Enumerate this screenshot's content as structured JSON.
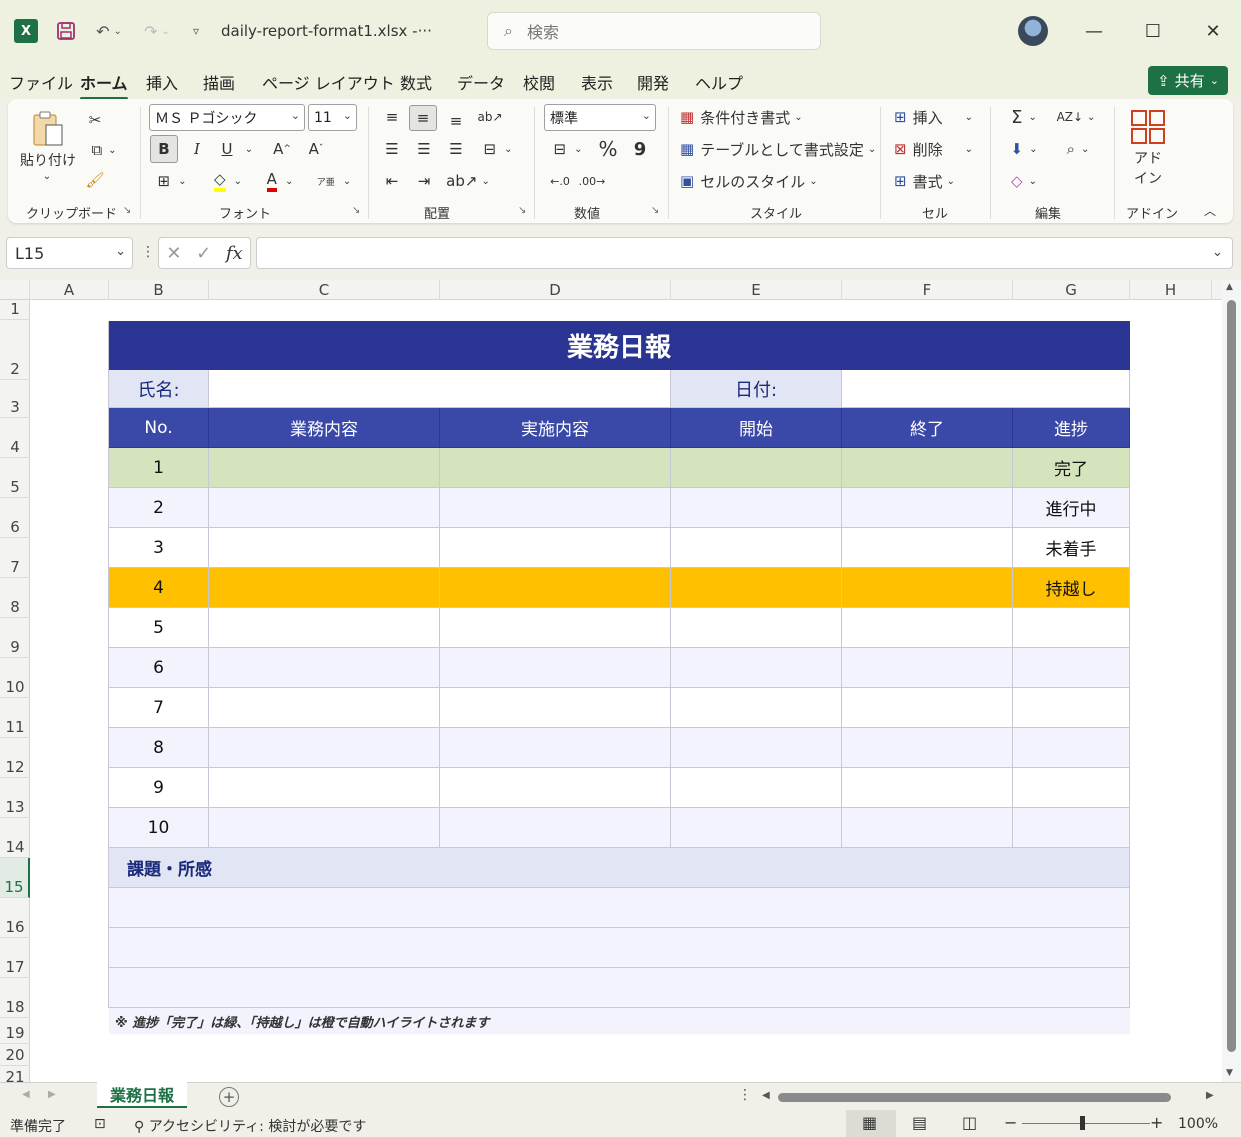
{
  "titlebar": {
    "filename": "daily-report-format1.xlsx  -···",
    "search_placeholder": "検索"
  },
  "ribbon_tabs": [
    {
      "label": "ファイル"
    },
    {
      "label": "ホーム",
      "active": true
    },
    {
      "label": "挿入"
    },
    {
      "label": "描画"
    },
    {
      "label": "ページ レイアウト"
    },
    {
      "label": "数式"
    },
    {
      "label": "データ"
    },
    {
      "label": "校閲"
    },
    {
      "label": "表示"
    },
    {
      "label": "開発"
    },
    {
      "label": "ヘルプ"
    }
  ],
  "share_label": "共有",
  "ribbon": {
    "clipboard": {
      "paste": "貼り付け",
      "group": "クリップボード"
    },
    "font": {
      "font_name": "ＭＳ Ｐゴシック",
      "font_size": "11",
      "bold": "B",
      "italic": "I",
      "underline": "U",
      "group": "フォント"
    },
    "alignment": {
      "group": "配置"
    },
    "number": {
      "format": "標準",
      "percent": "%",
      "comma": "9",
      "group": "数値"
    },
    "styles": {
      "conditional": "条件付き書式",
      "as_table": "テーブルとして書式設定",
      "cell_styles": "セルのスタイル",
      "group": "スタイル"
    },
    "cells": {
      "insert": "挿入",
      "delete": "削除",
      "format": "書式",
      "group": "セル"
    },
    "editing": {
      "group": "編集"
    },
    "addin": {
      "label_line1": "アド",
      "label_line2": "イン",
      "group": "アドイン"
    }
  },
  "formula_bar": {
    "namebox": "L15",
    "formula": ""
  },
  "columns": [
    "A",
    "B",
    "C",
    "D",
    "E",
    "F",
    "G",
    "H"
  ],
  "rows": [
    "1",
    "2",
    "3",
    "4",
    "5",
    "6",
    "7",
    "8",
    "9",
    "10",
    "11",
    "12",
    "13",
    "14",
    "15",
    "16",
    "17",
    "18",
    "19",
    "20",
    "21"
  ],
  "selected_row": "15",
  "report": {
    "title": "業務日報",
    "name_label": "氏名:",
    "name_value": "",
    "date_label": "日付:",
    "date_value": "",
    "headers": [
      "No.",
      "業務内容",
      "実施内容",
      "開始",
      "終了",
      "進捗"
    ],
    "rows": [
      {
        "no": "1",
        "task": "",
        "detail": "",
        "start": "",
        "end": "",
        "status": "完了"
      },
      {
        "no": "2",
        "task": "",
        "detail": "",
        "start": "",
        "end": "",
        "status": "進行中"
      },
      {
        "no": "3",
        "task": "",
        "detail": "",
        "start": "",
        "end": "",
        "status": "未着手"
      },
      {
        "no": "4",
        "task": "",
        "detail": "",
        "start": "",
        "end": "",
        "status": "持越し"
      },
      {
        "no": "5",
        "task": "",
        "detail": "",
        "start": "",
        "end": "",
        "status": ""
      },
      {
        "no": "6",
        "task": "",
        "detail": "",
        "start": "",
        "end": "",
        "status": ""
      },
      {
        "no": "7",
        "task": "",
        "detail": "",
        "start": "",
        "end": "",
        "status": ""
      },
      {
        "no": "8",
        "task": "",
        "detail": "",
        "start": "",
        "end": "",
        "status": ""
      },
      {
        "no": "9",
        "task": "",
        "detail": "",
        "start": "",
        "end": "",
        "status": ""
      },
      {
        "no": "10",
        "task": "",
        "detail": "",
        "start": "",
        "end": "",
        "status": ""
      }
    ],
    "issues_label": "課題・所感",
    "note": "※ 進捗「完了」は緑、「持越し」は橙で自動ハイライトされます"
  },
  "colors": {
    "title_bg": "#2a3492",
    "header_bg": "#3a48a8",
    "label_bg": "#e2e6f4",
    "done_bg": "#d6e4bd",
    "carry_bg": "#ffc000",
    "alt_row_bg": "#f2f3fc",
    "excel_green": "#1e7145"
  },
  "sheet_tab": "業務日報",
  "statusbar": {
    "ready": "準備完了",
    "accessibility": "アクセシビリティ: 検討が必要です",
    "zoom": "100%"
  }
}
